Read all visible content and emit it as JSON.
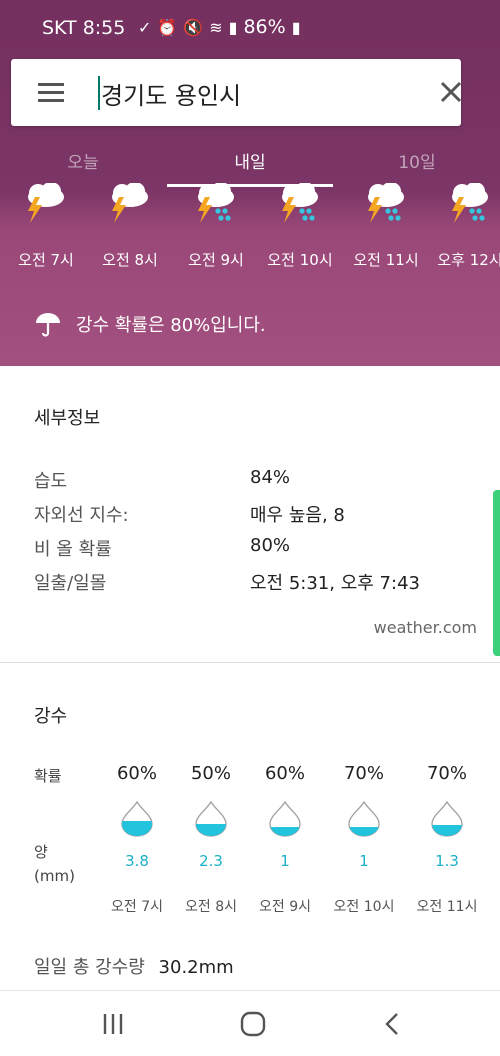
{
  "status": {
    "carrier_time": "SKT 8:55",
    "battery": "86%"
  },
  "search": {
    "value": "경기도 용인시"
  },
  "tabs": [
    "오늘",
    "내일",
    "10일"
  ],
  "hourly": {
    "labels": [
      "오전 7시",
      "오전 8시",
      "오전 9시",
      "오전 10시",
      "오전 11시",
      "오후 12시"
    ],
    "icons": [
      "thunderstorm-icon",
      "thunderstorm-icon",
      "thunder-rain-icon",
      "thunder-rain-icon",
      "thunder-rain-icon",
      "thunder-rain-icon"
    ]
  },
  "rain_probability_text": "강수 확률은 80%입니다.",
  "details": {
    "title": "세부정보",
    "rows": [
      {
        "label": "습도",
        "value": "84%"
      },
      {
        "label": "자외선 지수:",
        "value": "매우 높음, 8"
      },
      {
        "label": "비 올 확률",
        "value": "80%"
      },
      {
        "label": "일출/일몰",
        "value": "오전 5:31, 오후 7:43"
      }
    ],
    "source": "weather.com"
  },
  "precip": {
    "title": "강수",
    "prob_label": "확률",
    "amount_label_1": "양",
    "amount_label_2": "(mm)",
    "columns": [
      {
        "prob": "60%",
        "amount": "3.8",
        "time": "오전 7시",
        "fill": 0.6
      },
      {
        "prob": "50%",
        "amount": "2.3",
        "time": "오전 8시",
        "fill": 0.5
      },
      {
        "prob": "60%",
        "amount": "1",
        "time": "오전 9시",
        "fill": 0.4
      },
      {
        "prob": "70%",
        "amount": "1",
        "time": "오전 10시",
        "fill": 0.4
      },
      {
        "prob": "70%",
        "amount": "1.3",
        "time": "오전 11시",
        "fill": 0.45
      }
    ],
    "total_label": "일일 총 강수량",
    "total_value": "30.2mm"
  },
  "colors": {
    "header": "#7b3566",
    "accent": "#1db0c6",
    "drop_fill": "#22c3dc"
  }
}
